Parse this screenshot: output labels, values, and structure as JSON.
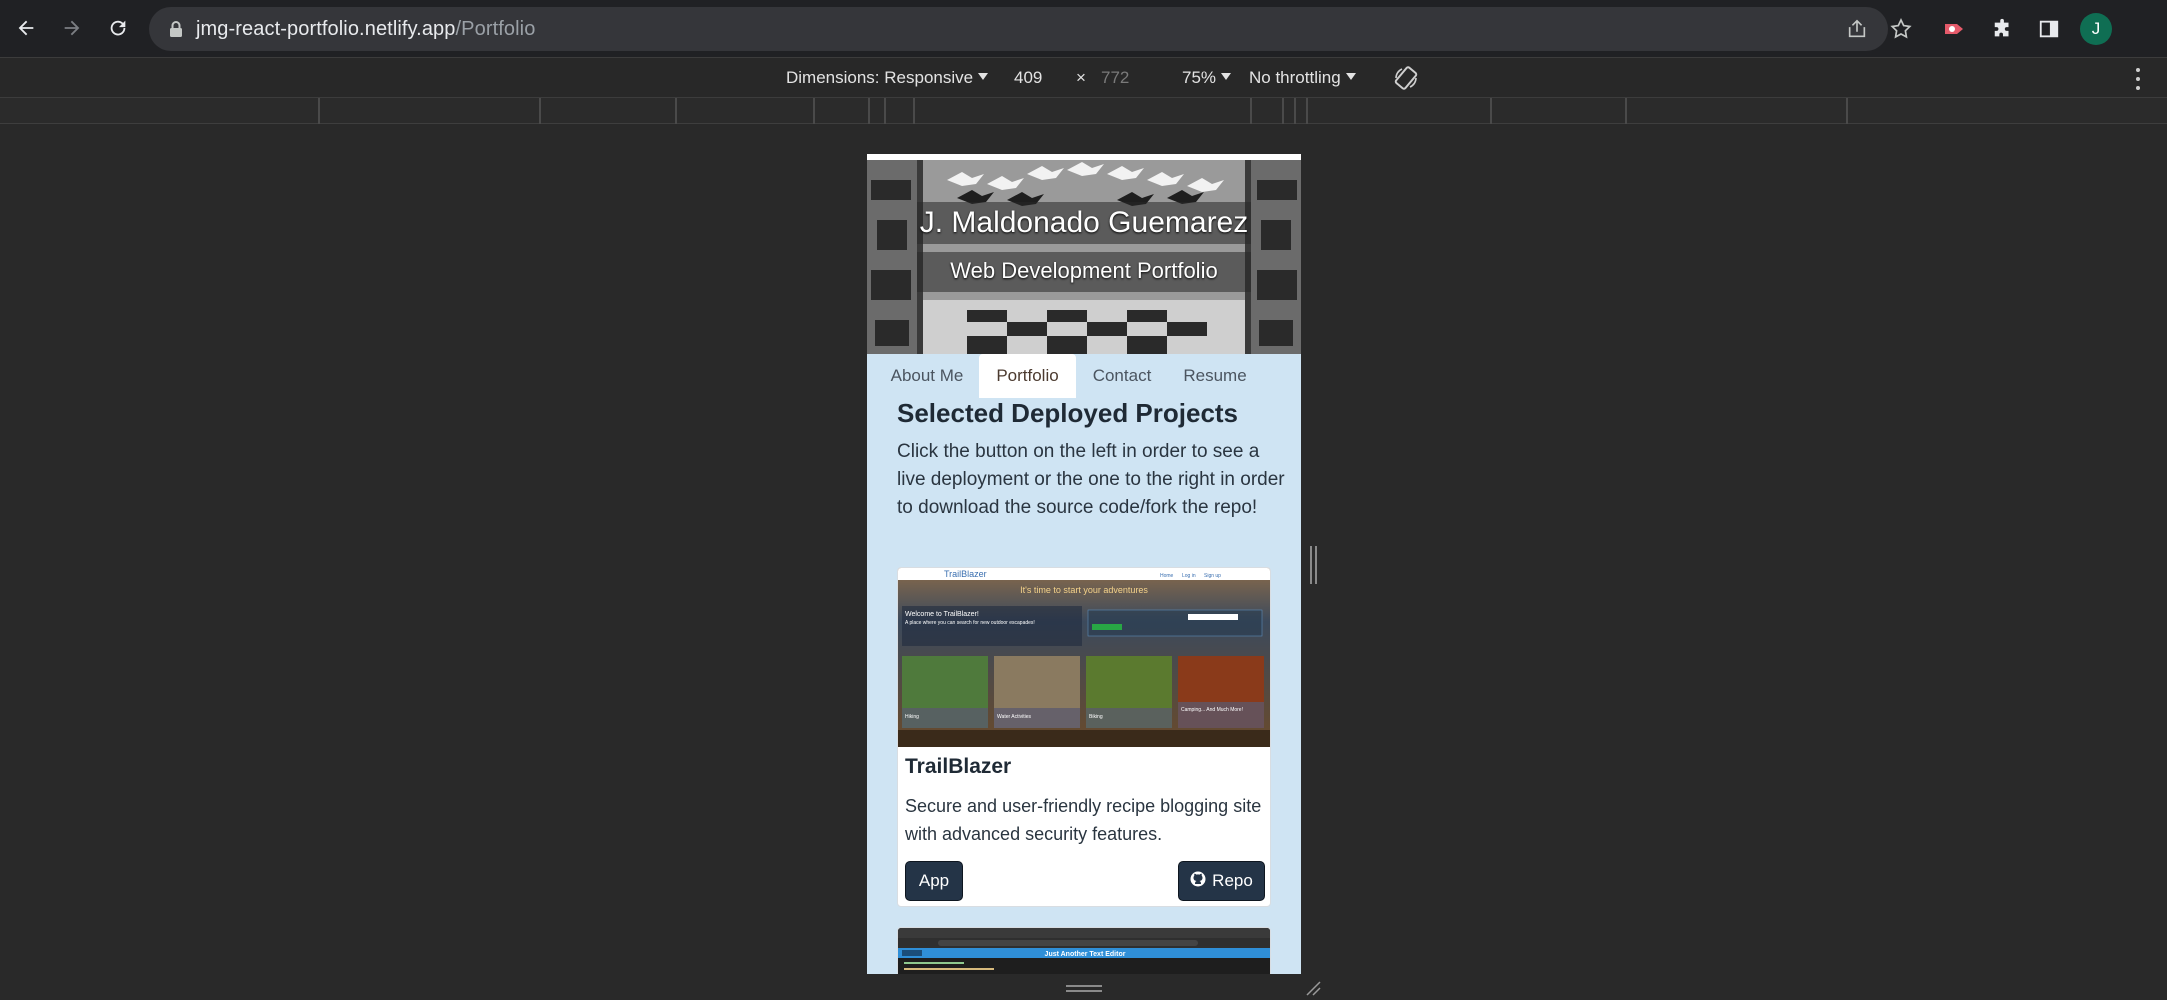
{
  "browser": {
    "url_host": "jmg-react-portfolio.netlify.app",
    "url_path": "/Portfolio",
    "avatar_letter": "J",
    "icons": [
      "back-icon",
      "forward-icon",
      "reload-icon",
      "lock-icon",
      "share-icon",
      "star-icon",
      "extension-record-icon",
      "puzzle-icon",
      "side-panel-icon"
    ]
  },
  "devtools": {
    "dimensions_label": "Dimensions: Responsive",
    "width": "409",
    "times": "×",
    "height": "772",
    "zoom": "75%",
    "throttling": "No throttling"
  },
  "page": {
    "hero_title": "J. Maldonado Guemarez",
    "hero_subtitle": "Web Development Portfolio",
    "tabs": [
      {
        "label": "About Me"
      },
      {
        "label": "Portfolio",
        "active": true
      },
      {
        "label": "Contact"
      },
      {
        "label": "Resume"
      }
    ],
    "section_title": "Selected Deployed Projects",
    "intro": "Click the button on the left in order to see a live deployment or the one to the right in order to download the source code/fork the repo!",
    "projects": [
      {
        "title": "TrailBlazer",
        "description": "Secure and user-friendly recipe blogging site with advanced security features.",
        "app_label": "App",
        "repo_label": "Repo",
        "screenshot": {
          "brand": "TrailBlazer",
          "nav": [
            "Home",
            "Log in",
            "Sign up"
          ],
          "banner": "It's time to start your adventures",
          "welcome": "Welcome to TrailBlazer!",
          "tagline": "A place where you can search for new outdoor escapades!",
          "tiles": [
            "Hiking",
            "Water Activities",
            "Biking",
            "Camping... And Much More!"
          ]
        }
      },
      {
        "screenshot_title": "Just Another Text Editor"
      }
    ]
  },
  "colors": {
    "page_bg": "#cfe4f3",
    "button_bg": "#243447",
    "browser_bg": "#202124"
  }
}
